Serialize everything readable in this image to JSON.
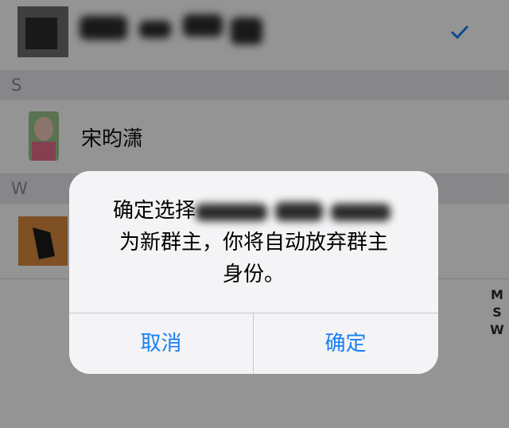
{
  "sections": [
    {
      "letter": "S",
      "contacts": [
        {
          "name": "宋昀潇"
        }
      ]
    },
    {
      "letter": "W",
      "contacts": [
        {
          "name": ""
        }
      ]
    }
  ],
  "index_letters": [
    "M",
    "S",
    "W"
  ],
  "selected_icon": "checkmark-icon",
  "dialog": {
    "message_line1": "确定选择",
    "message_line2": "为新群主，你将自动放弃群主",
    "message_line3": "身份。",
    "cancel_label": "取消",
    "confirm_label": "确定"
  },
  "colors": {
    "accent": "#1a7ff2",
    "section_header_bg": "#e9e9ee",
    "dialog_bg": "#f4f4f6"
  }
}
